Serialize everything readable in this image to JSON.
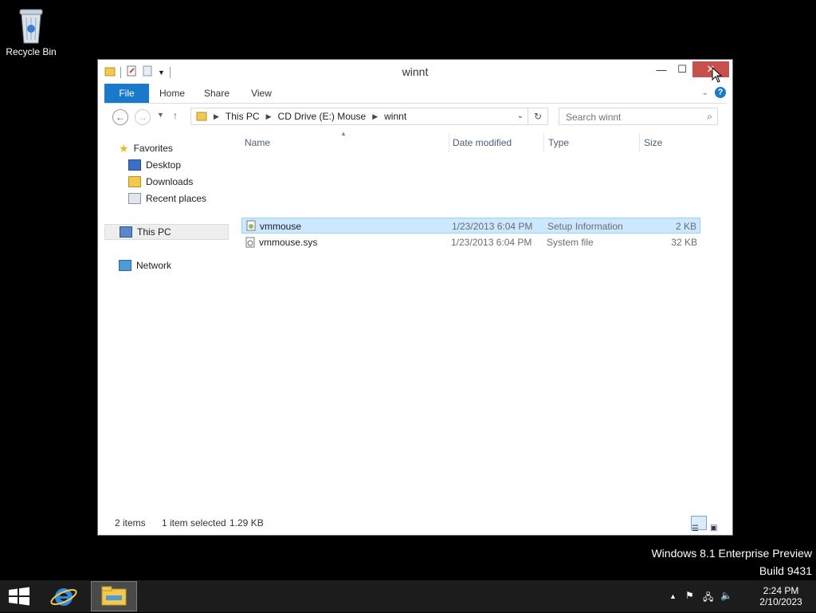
{
  "desktop": {
    "recycle_bin_label": "Recycle Bin",
    "watermark_line1": "Windows 8.1 Enterprise Preview",
    "watermark_line2": "Build 9431"
  },
  "window": {
    "title": "winnt",
    "ribbon_tabs": [
      "File",
      "Home",
      "Share",
      "View"
    ],
    "address": {
      "crumbs": [
        "This PC",
        "CD Drive (E:) Mouse",
        "winnt"
      ]
    },
    "search": {
      "placeholder": "Search winnt"
    },
    "nav_pane": {
      "favorites_label": "Favorites",
      "favorites": [
        "Desktop",
        "Downloads",
        "Recent places"
      ],
      "this_pc": "This PC",
      "network": "Network"
    },
    "columns": {
      "name": "Name",
      "date": "Date modified",
      "type": "Type",
      "size": "Size"
    },
    "files": [
      {
        "name": "vmmouse",
        "date": "1/23/2013 6:04 PM",
        "type": "Setup Information",
        "size": "2 KB",
        "selected": true
      },
      {
        "name": "vmmouse.sys",
        "date": "1/23/2013 6:04 PM",
        "type": "System file",
        "size": "32 KB",
        "selected": false
      }
    ],
    "status": {
      "items": "2 items",
      "selected": "1 item selected",
      "size": "1.29 KB"
    }
  },
  "taskbar": {
    "time": "2:24 PM",
    "date": "2/10/2023"
  },
  "colors": {
    "accent": "#1979ca",
    "close": "#c7504a",
    "selection": "#cce8ff"
  }
}
